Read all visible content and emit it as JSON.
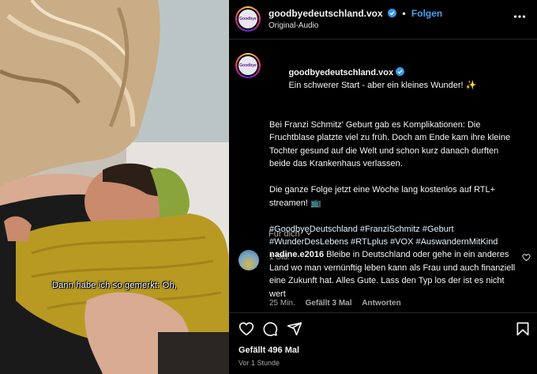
{
  "video": {
    "subtitle": "Dann habe ich so gemerkt: Oh,"
  },
  "header": {
    "avatar_text": "Goodbye Deutschland",
    "username": "goodbyedeutschland.vox",
    "separator": "•",
    "follow_label": "Folgen",
    "audio": "Original-Audio"
  },
  "caption": {
    "username": "goodbyedeutschland.vox",
    "intro": "Ein schwerer Start - aber ein kleines Wunder! ✨",
    "paragraph1": "Bei Franzi Schmitz' Geburt gab es Komplikationen: Die Fruchtblase platzte viel zu früh. Doch am Ende kam ihre kleine Tochter gesund auf die Welt und schon kurz danach durften beide das Krankenhaus verlassen.",
    "paragraph2": "Die ganze Folge jetzt eine Woche lang kostenlos auf RTL+ streamen! 📺",
    "hashtags": "#GoodbyeDeutschland #FranziSchmitz #Geburt #WunderDesLebens #RTLplus #VOX #AuswandernMitKind",
    "age": "1 Std."
  },
  "translate_label": "Für dich",
  "comment": {
    "username": "nadine.e2016",
    "text": "Bleibe in Deutschland oder gehe in ein anderes Land wo man vernünftig leben kann als Frau und auch finanziell eine Zukunft hat. Alles Gute. Lass den Typ los der ist es nicht wert",
    "age": "25 Min.",
    "likes": "Gefällt 3 Mal",
    "reply_label": "Antworten"
  },
  "actions": {
    "icons": [
      "heart-icon",
      "comment-icon",
      "share-icon",
      "bookmark-icon"
    ],
    "likes": "Gefällt 496 Mal",
    "time": "Vor 1 Stunde"
  },
  "colors": {
    "background": "#000000",
    "link_blue": "#4aa3f2",
    "secondary_text": "#a8a8a8",
    "divider": "#262626",
    "hashtag": "#e0f1ff"
  }
}
